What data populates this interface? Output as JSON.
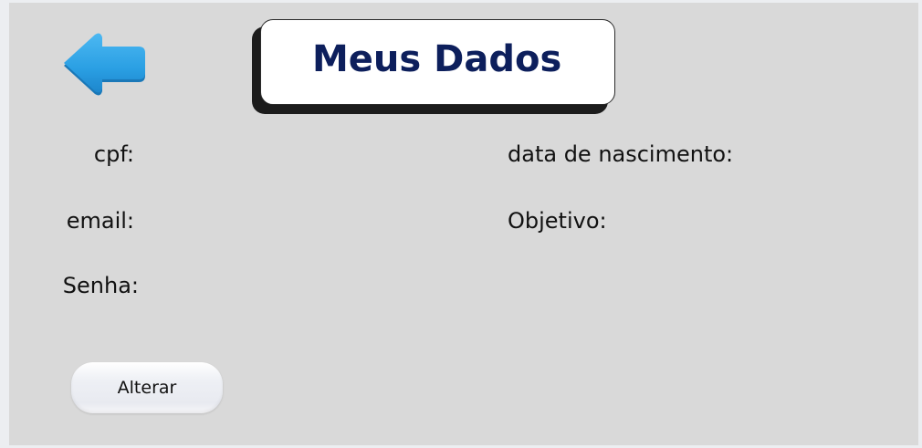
{
  "header": {
    "title": "Meus Dados",
    "back_icon": "back-arrow-icon",
    "back_icon_color": "#2ea3e6"
  },
  "fields": {
    "cpf_label": "cpf:",
    "email_label": "email:",
    "senha_label": "Senha:",
    "nascimento_label": "data de nascimento:",
    "objetivo_label": "Objetivo:"
  },
  "actions": {
    "alterar_label": "Alterar"
  },
  "colors": {
    "panel_background": "#d9d9d9",
    "title_text": "#0d1f5c"
  }
}
